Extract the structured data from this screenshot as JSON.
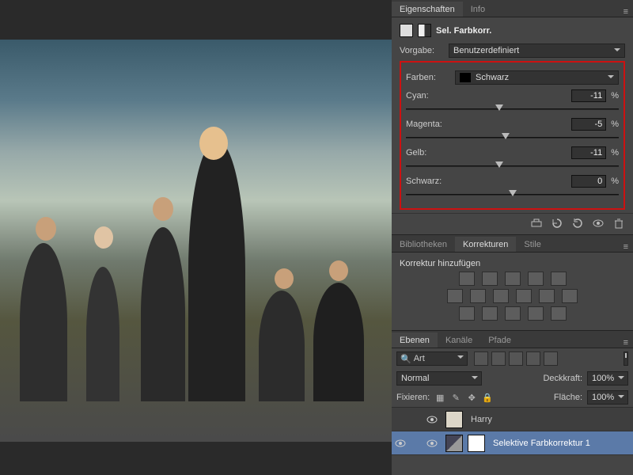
{
  "properties": {
    "tabs": [
      "Eigenschaften",
      "Info"
    ],
    "activeTab": 0,
    "title": "Sel. Farbkorr.",
    "presetLabel": "Vorgabe:",
    "presetValue": "Benutzerdefiniert",
    "colorsLabel": "Farben:",
    "colorsValue": "Schwarz",
    "sliders": [
      {
        "name": "Cyan:",
        "value": "-11",
        "pct": "%",
        "pos": 44
      },
      {
        "name": "Magenta:",
        "value": "-5",
        "pct": "%",
        "pos": 47
      },
      {
        "name": "Gelb:",
        "value": "-11",
        "pct": "%",
        "pos": 44
      },
      {
        "name": "Schwarz:",
        "value": "0",
        "pct": "%",
        "pos": 50
      }
    ],
    "footerIcons": [
      "clip-icon",
      "prev-state-icon",
      "reset-icon",
      "visibility-icon",
      "trash-icon"
    ]
  },
  "corrections": {
    "tabs": [
      "Bibliotheken",
      "Korrekturen",
      "Stile"
    ],
    "activeTab": 1,
    "addLabel": "Korrektur hinzufügen",
    "row1": [
      "brightness-contrast",
      "levels",
      "curves",
      "exposure",
      "vibrance"
    ],
    "row2": [
      "hue-sat",
      "color-balance",
      "bw",
      "photo-filter",
      "channel-mixer",
      "color-lookup"
    ],
    "row3": [
      "invert",
      "posterize",
      "threshold",
      "gradient-map",
      "selective-color"
    ]
  },
  "layers": {
    "tabs": [
      "Ebenen",
      "Kanäle",
      "Pfade"
    ],
    "activeTab": 0,
    "searchPlaceholder": "Art",
    "filterIcons": [
      "filter-pixel",
      "filter-adjust",
      "filter-type",
      "filter-shape",
      "filter-smart"
    ],
    "blendMode": "Normal",
    "opacityLabel": "Deckkraft:",
    "opacityValue": "100%",
    "lockLabel": "Fixieren:",
    "lockIcons": [
      "lock-transparent",
      "lock-paint",
      "lock-move",
      "lock-all"
    ],
    "fillLabel": "Fläche:",
    "fillValue": "100%",
    "items": [
      {
        "visible": false,
        "name": "Harry",
        "type": "pixel",
        "selected": false
      },
      {
        "visible": true,
        "name": "Selektive Farbkorrektur 1",
        "type": "adjustment",
        "selected": true
      }
    ]
  }
}
